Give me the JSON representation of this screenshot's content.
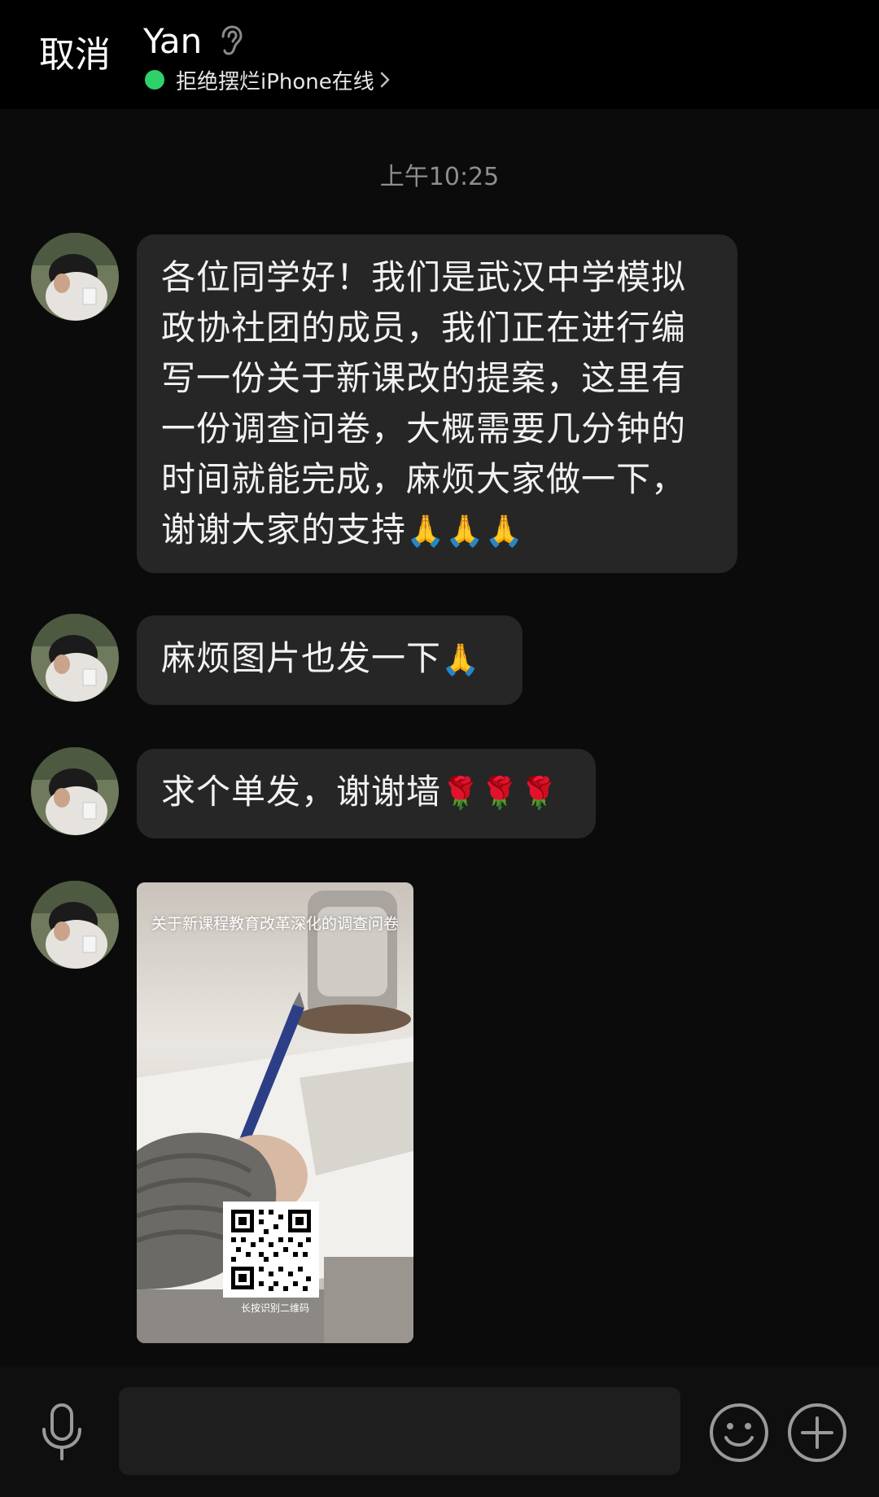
{
  "header": {
    "cancel_label": "取消",
    "contact_name": "Yan",
    "status_text": "拒绝摆烂iPhone在线",
    "status_color": "#2fd26a",
    "icons": [
      "ear-icon",
      "chevron-right-icon"
    ]
  },
  "chat": {
    "timestamp": "上午10:25",
    "messages": [
      {
        "type": "text",
        "text": "各位同学好！我们是武汉中学模拟\n政协社团的成员，我们正在进行编\n写一份关于新课改的提案，这里有\n一份调查问卷，大概需要几分钟的\n时间就能完成，麻烦大家做一下，\n谢谢大家的支持",
        "emoji": "🙏🙏🙏"
      },
      {
        "type": "text",
        "text": "麻烦图片也发一下",
        "emoji": "🙏"
      },
      {
        "type": "text",
        "text": "求个单发，谢谢墙",
        "emoji": "🌹🌹🌹"
      },
      {
        "type": "image",
        "title": "关于新课程教育改革深化的调查问卷",
        "qr_caption": "长按识别二维码"
      }
    ]
  },
  "input_bar": {
    "text_value": "",
    "icons": [
      "microphone-icon",
      "smiley-icon",
      "plus-icon"
    ]
  },
  "colors": {
    "background": "#0b0b0b",
    "header_background": "#000000",
    "bubble_background": "#262626",
    "timestamp_text": "#8e8e8e"
  }
}
